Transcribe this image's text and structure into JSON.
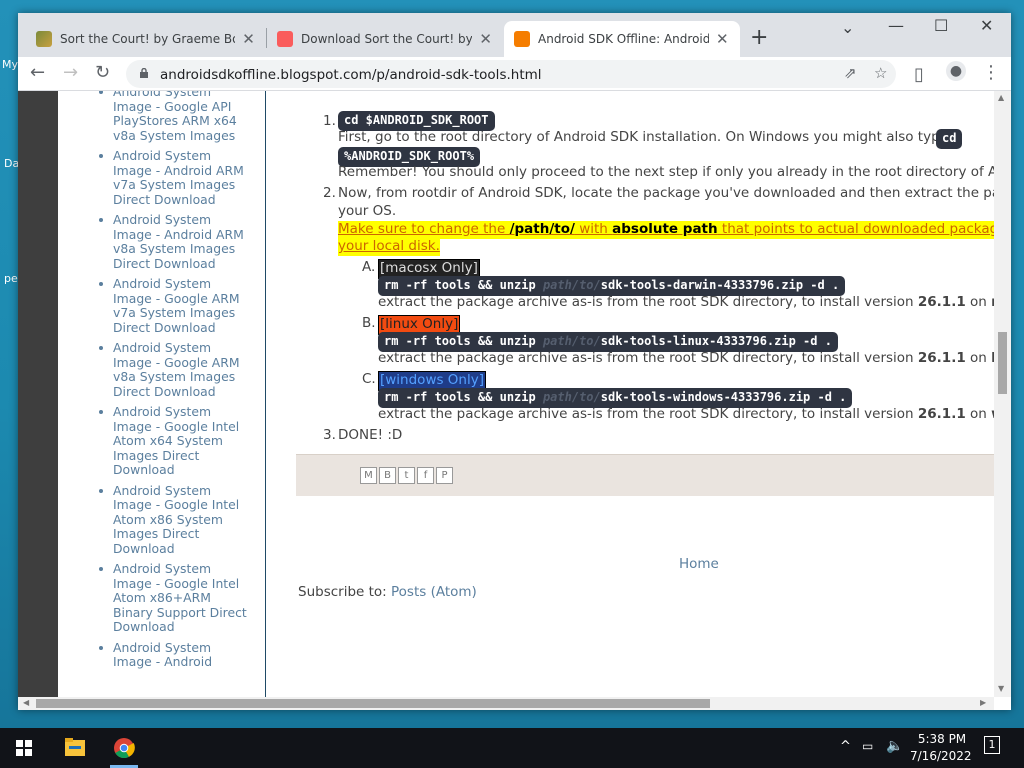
{
  "desktop": {
    "labels": [
      "My",
      "Da",
      "pe"
    ]
  },
  "tabs": [
    {
      "title": "Sort the Court! by Graeme Borland"
    },
    {
      "title": "Download Sort the Court! by Graeme Borland"
    },
    {
      "title": "Android SDK Offline: Android SDK Tools"
    }
  ],
  "address": {
    "url": "androidsdkoffline.blogspot.com/p/android-sdk-tools.html"
  },
  "sidebar": {
    "items": [
      {
        "label": "Android System Image - Google API PlayStores ARM x64 v8a System Images"
      },
      {
        "label": "Android System Image - Android ARM v7a System Images Direct Download"
      },
      {
        "label": "Android System Image - Android ARM v8a System Images Direct Download"
      },
      {
        "label": "Android System Image - Google ARM v7a System Images Direct Download"
      },
      {
        "label": "Android System Image - Google ARM v8a System Images Direct Download"
      },
      {
        "label": "Android System Image - Google Intel Atom x64 System Images Direct Download"
      },
      {
        "label": "Android System Image - Google Intel Atom x86 System Images Direct Download"
      },
      {
        "label": "Android System Image - Google Intel Atom x86+ARM Binary Support Direct Download"
      },
      {
        "label": "Android System Image - Android"
      }
    ]
  },
  "main": {
    "step1": {
      "num": "1.",
      "code": "cd $ANDROID_SDK_ROOT",
      "text": "First, go to the root directory of Android SDK installation. On Windows you might also type",
      "code_win_a": "cd",
      "code_win_b": "%ANDROID_SDK_ROOT%",
      "remember": "Remember! You should only proceed to the next step if only you already in the root directory of And"
    },
    "step2": {
      "num": "2.",
      "text_a": "Now, from rootdir of Android SDK, locate the package you've downloaded and then extract the pack",
      "text_b": "your OS.",
      "hl_a": "Make sure to change the ",
      "hl_b": "/path/to/",
      "hl_c": " with ",
      "hl_d": "absolute path",
      "hl_e": " that points to actual downloaded package file",
      "hl_f": "your local disk."
    },
    "subs": [
      {
        "letter": "A.",
        "tag": "[macosx Only]",
        "cmd_a": "rm -rf tools && unzip ",
        "cmd_path": "path/to/",
        "cmd_b": "sdk-tools-darwin-4333796.zip -d .",
        "desc_a": "extract the package archive as-is from the root SDK directory, to install version ",
        "version": "26.1.1",
        "desc_b": " on ",
        "os": "macos"
      },
      {
        "letter": "B.",
        "tag": "[linux Only]",
        "cmd_a": "rm -rf tools && unzip ",
        "cmd_path": "path/to/",
        "cmd_b": "sdk-tools-linux-4333796.zip -d .",
        "desc_a": "extract the package archive as-is from the root SDK directory, to install version ",
        "version": "26.1.1",
        "desc_b": " on ",
        "os": "linux"
      },
      {
        "letter": "C.",
        "tag": "[windows Only]",
        "cmd_a": "rm -rf tools && unzip ",
        "cmd_path": "path/to/",
        "cmd_b": "sdk-tools-windows-4333796.zip -d .",
        "desc_a": "extract the package archive as-is from the root SDK directory, to install version ",
        "version": "26.1.1",
        "desc_b": " on ",
        "os": "windo"
      }
    ],
    "step3": {
      "num": "3.",
      "text": "DONE! :D"
    },
    "home": "Home",
    "subscribe_a": "Subscribe to: ",
    "subscribe_b": "Posts (Atom)"
  },
  "taskbar": {
    "time": "5:38 PM",
    "date": "7/16/2022",
    "notify_count": "1"
  },
  "colors": {
    "chrome_frame": "#dee1e6",
    "code_bg": "#2f3542",
    "highlight": "#ffff00",
    "link": "#5b7f9e"
  }
}
